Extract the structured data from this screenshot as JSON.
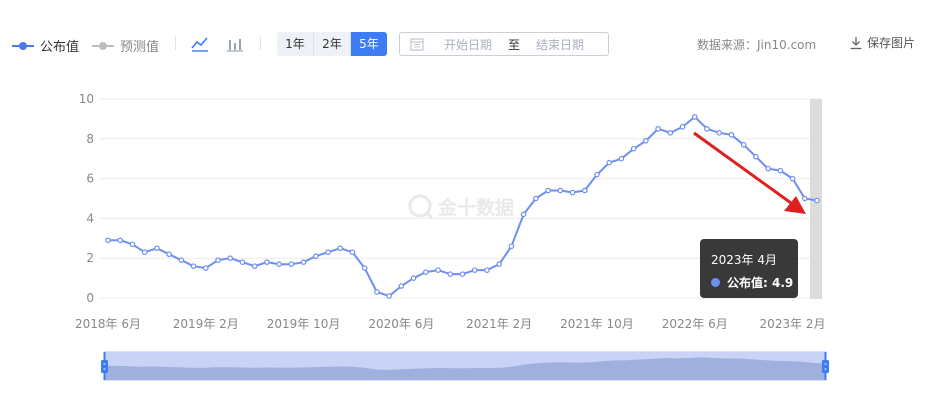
{
  "legend": {
    "published_label": "公布值",
    "forecast_label": "预测值",
    "published_color": "#4a7ae6",
    "forecast_color": "#bdbdbd"
  },
  "toolbar": {
    "line_icon": "line-chart-icon",
    "bar_icon": "bar-chart-icon",
    "ranges": [
      "1年",
      "2年",
      "5年"
    ],
    "active_range": "5年",
    "date_start_placeholder": "开始日期",
    "date_separator": "至",
    "date_end_placeholder": "结束日期",
    "source": "数据来源：Jin10.com",
    "save_label": "保存图片"
  },
  "watermark": "金十数据",
  "tooltip": {
    "title": "2023年 4月",
    "series_label": "公布值: 4.9"
  },
  "chart_data": {
    "type": "line",
    "title": "",
    "xlabel": "",
    "ylabel": "",
    "ylim": [
      0,
      10
    ],
    "yticks": [
      "0",
      "2",
      "4",
      "6",
      "8",
      "10"
    ],
    "xtick_labels": [
      "2018年 6月",
      "2019年 2月",
      "2019年 10月",
      "2020年 6月",
      "2021年 2月",
      "2021年 10月",
      "2022年 6月",
      "2023年 2月"
    ],
    "grid": true,
    "line_color": "#6e8ff0",
    "series": [
      {
        "name": "公布值",
        "x": [
          "2018-06",
          "2018-07",
          "2018-08",
          "2018-09",
          "2018-10",
          "2018-11",
          "2018-12",
          "2019-01",
          "2019-02",
          "2019-03",
          "2019-04",
          "2019-05",
          "2019-06",
          "2019-07",
          "2019-08",
          "2019-09",
          "2019-10",
          "2019-11",
          "2019-12",
          "2020-01",
          "2020-02",
          "2020-03",
          "2020-04",
          "2020-05",
          "2020-06",
          "2020-07",
          "2020-08",
          "2020-09",
          "2020-10",
          "2020-11",
          "2020-12",
          "2021-01",
          "2021-02",
          "2021-03",
          "2021-04",
          "2021-05",
          "2021-06",
          "2021-07",
          "2021-08",
          "2021-09",
          "2021-10",
          "2021-11",
          "2021-12",
          "2022-01",
          "2022-02",
          "2022-03",
          "2022-04",
          "2022-05",
          "2022-06",
          "2022-07",
          "2022-08",
          "2022-09",
          "2022-10",
          "2022-11",
          "2022-12",
          "2023-01",
          "2023-02",
          "2023-03",
          "2023-04"
        ],
        "values": [
          2.9,
          2.9,
          2.7,
          2.3,
          2.5,
          2.2,
          1.9,
          1.6,
          1.5,
          1.9,
          2.0,
          1.8,
          1.6,
          1.8,
          1.7,
          1.7,
          1.8,
          2.1,
          2.3,
          2.5,
          2.3,
          1.5,
          0.3,
          0.1,
          0.6,
          1.0,
          1.3,
          1.4,
          1.2,
          1.2,
          1.4,
          1.4,
          1.7,
          2.6,
          4.2,
          5.0,
          5.4,
          5.4,
          5.3,
          5.4,
          6.2,
          6.8,
          7.0,
          7.5,
          7.9,
          8.5,
          8.3,
          8.6,
          9.1,
          8.5,
          8.3,
          8.2,
          7.7,
          7.1,
          6.5,
          6.4,
          6.0,
          5.0,
          4.9
        ]
      }
    ],
    "highlighted_point": "2023-04",
    "annotation": "red-arrow-to-latest-point"
  },
  "zoom_slider": {
    "range_start": 0,
    "range_end": 1
  }
}
